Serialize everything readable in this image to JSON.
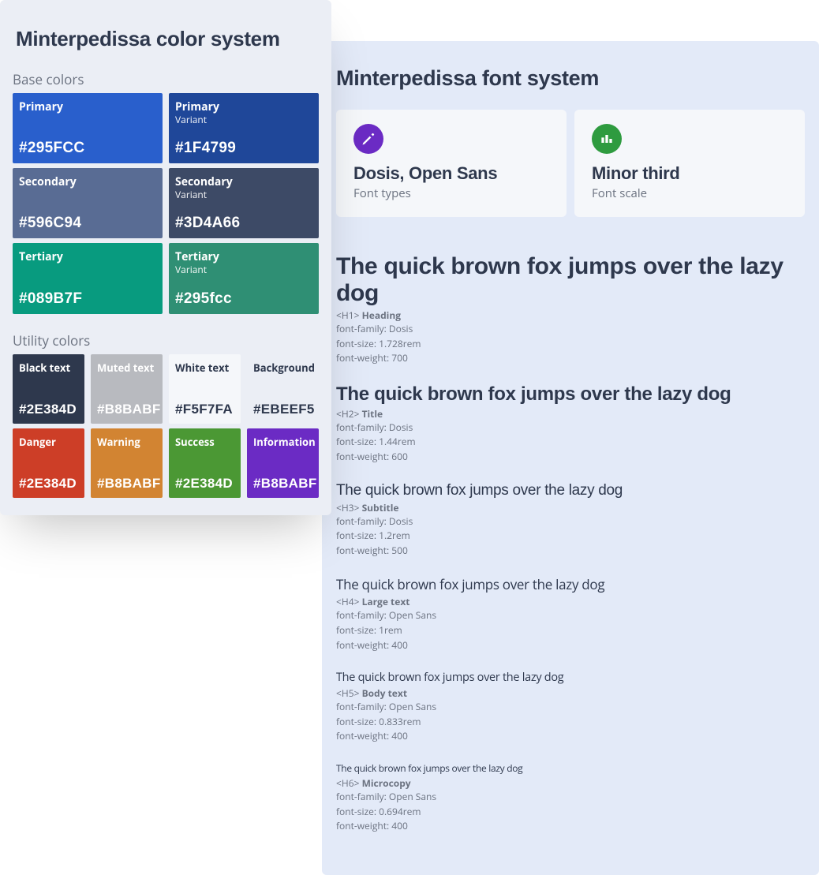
{
  "colorPanel": {
    "title": "Minterpedissa color system",
    "baseLabel": "Base colors",
    "utilityLabel": "Utility colors",
    "base": [
      [
        {
          "name": "Primary",
          "variant": "",
          "hex": "#295FCC",
          "bg": "#295FCC",
          "light": false
        },
        {
          "name": "Primary",
          "variant": "Variant",
          "hex": "#1F4799",
          "bg": "#1F4799",
          "light": false
        }
      ],
      [
        {
          "name": "Secondary",
          "variant": "",
          "hex": "#596C94",
          "bg": "#596C94",
          "light": false
        },
        {
          "name": "Secondary",
          "variant": "Variant",
          "hex": "#3D4A66",
          "bg": "#3D4A66",
          "light": false
        }
      ],
      [
        {
          "name": "Tertiary",
          "variant": "",
          "hex": "#089B7F",
          "bg": "#089B7F",
          "light": false
        },
        {
          "name": "Tertiary",
          "variant": "Variant",
          "hex": "#295fcc",
          "bg": "#2F8F74",
          "light": false
        }
      ]
    ],
    "utility": [
      [
        {
          "name": "Black text",
          "hex": "#2E384D",
          "bg": "#2E384D",
          "light": false
        },
        {
          "name": "Muted text",
          "hex": "#B8BABF",
          "bg": "#B8BABF",
          "light": false
        },
        {
          "name": "White text",
          "hex": "#F5F7FA",
          "bg": "#F5F7FA",
          "light": true
        },
        {
          "name": "Background",
          "hex": "#EBEEF5",
          "bg": "#EBEEF5",
          "light": true
        }
      ],
      [
        {
          "name": "Danger",
          "hex": "#2E384D",
          "bg": "#CD3E27",
          "light": false
        },
        {
          "name": "Warning",
          "hex": "#B8BABF",
          "bg": "#D28432",
          "light": false
        },
        {
          "name": "Success",
          "hex": "#2E384D",
          "bg": "#4B9834",
          "light": false
        },
        {
          "name": "Information",
          "hex": "#B8BABF",
          "bg": "#6B2BC4",
          "light": false
        }
      ]
    ]
  },
  "fontPanel": {
    "title": "Minterpedissa font system",
    "cards": [
      {
        "icon": "pen",
        "iconBg": "#6B2BC4",
        "title": "Dosis, Open Sans",
        "sub": "Font types"
      },
      {
        "icon": "chart",
        "iconBg": "#2E9B3F",
        "title": "Minor third",
        "sub": "Font scale"
      }
    ],
    "sample": "The quick brown fox jumps over the lazy dog",
    "specimens": [
      {
        "cls": "h1",
        "tag": "<H1>",
        "role": "Heading",
        "family": "Dosis",
        "size": "1.728rem",
        "weight": "700"
      },
      {
        "cls": "h2",
        "tag": "<H2>",
        "role": "Title",
        "family": "Dosis",
        "size": "1.44rem",
        "weight": "600"
      },
      {
        "cls": "h3",
        "tag": "<H3>",
        "role": "Subtitle",
        "family": "Dosis",
        "size": "1.2rem",
        "weight": "500"
      },
      {
        "cls": "h4",
        "tag": "<H4>",
        "role": "Large text",
        "family": "Open Sans",
        "size": "1rem",
        "weight": "400"
      },
      {
        "cls": "h5",
        "tag": "<H5>",
        "role": "Body text",
        "family": "Open Sans",
        "size": "0.833rem",
        "weight": "400"
      },
      {
        "cls": "h6",
        "tag": "<H6>",
        "role": "Microcopy",
        "family": "Open Sans",
        "size": "0.694rem",
        "weight": "400"
      }
    ]
  }
}
